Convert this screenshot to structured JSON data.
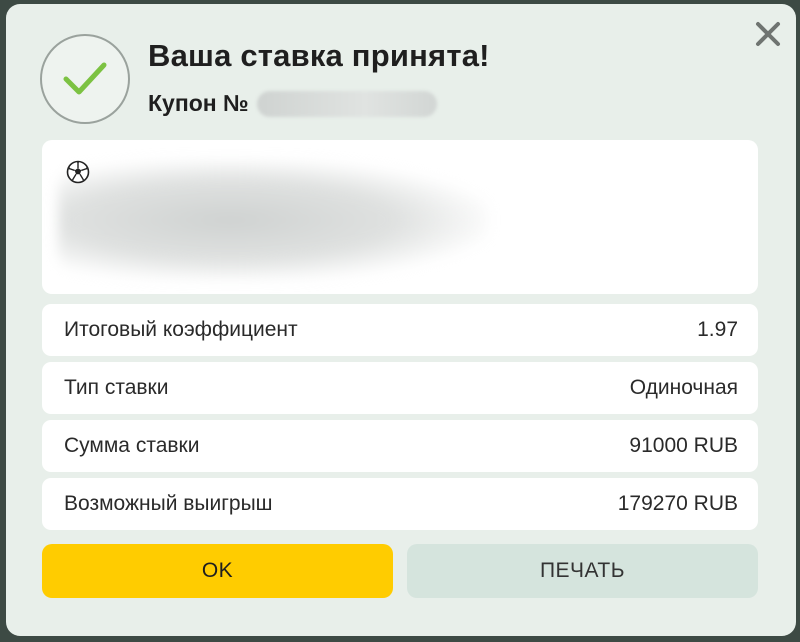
{
  "dialog": {
    "title": "Ваша ставка принята!",
    "coupon_label": "Купон №",
    "close_icon": "close-icon",
    "success_icon": "checkmark-icon",
    "sport_icon": "soccer-ball-icon"
  },
  "details": [
    {
      "label": "Итоговый коэффициент",
      "value": "1.97"
    },
    {
      "label": "Тип ставки",
      "value": "Одиночная"
    },
    {
      "label": "Сумма ставки",
      "value": "91000 RUB"
    },
    {
      "label": "Возможный выигрыш",
      "value": "179270 RUB"
    }
  ],
  "buttons": {
    "ok_label": "OK",
    "print_label": "ПЕЧАТЬ"
  },
  "colors": {
    "accent_yellow": "#ffcc00",
    "success_green": "#7cc242",
    "secondary_button": "#d5e4dd",
    "dialog_background": "#e8efea"
  }
}
